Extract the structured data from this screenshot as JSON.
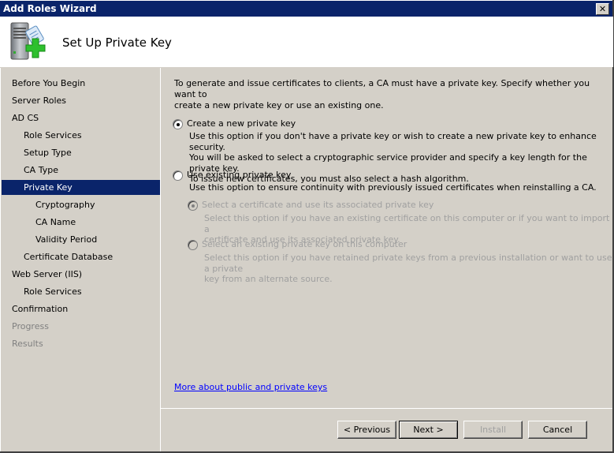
{
  "window": {
    "title": "Add Roles Wizard",
    "close_label": "✕"
  },
  "header": {
    "icon": "server-add-icon",
    "title": "Set Up Private Key"
  },
  "sidebar": {
    "items": [
      {
        "label": "Before You Begin",
        "level": 0,
        "state": "normal"
      },
      {
        "label": "Server Roles",
        "level": 0,
        "state": "normal"
      },
      {
        "label": "AD CS",
        "level": 0,
        "state": "normal"
      },
      {
        "label": "Role Services",
        "level": 1,
        "state": "normal"
      },
      {
        "label": "Setup Type",
        "level": 1,
        "state": "normal"
      },
      {
        "label": "CA Type",
        "level": 1,
        "state": "normal"
      },
      {
        "label": "Private Key",
        "level": 1,
        "state": "selected"
      },
      {
        "label": "Cryptography",
        "level": 2,
        "state": "normal"
      },
      {
        "label": "CA Name",
        "level": 2,
        "state": "normal"
      },
      {
        "label": "Validity Period",
        "level": 2,
        "state": "normal"
      },
      {
        "label": "Certificate Database",
        "level": 1,
        "state": "normal"
      },
      {
        "label": "Web Server (IIS)",
        "level": 0,
        "state": "normal"
      },
      {
        "label": "Role Services",
        "level": 1,
        "state": "normal"
      },
      {
        "label": "Confirmation",
        "level": 0,
        "state": "normal"
      },
      {
        "label": "Progress",
        "level": 0,
        "state": "disabled"
      },
      {
        "label": "Results",
        "level": 0,
        "state": "disabled"
      }
    ]
  },
  "main": {
    "intro_line1": "To generate and issue certificates to clients, a CA must have a private key. Specify whether you want to",
    "intro_line2": "create a new private key or use an existing one.",
    "options": {
      "create_new": {
        "label": "Create a new private key",
        "selected": true,
        "desc1": "Use this option if you don't have a private key or wish to create a new private key to enhance security.",
        "desc2": "You will be asked to select a cryptographic service provider and specify a key length for the private key.",
        "desc3": "To issue new certificates, you must also select a hash algorithm."
      },
      "use_existing": {
        "label": "Use existing private key",
        "selected": false,
        "desc1": "Use this option to ensure continuity with previously issued certificates when reinstalling a CA."
      },
      "select_certificate": {
        "label": "Select a certificate and use its associated private key",
        "selected": true,
        "enabled": false,
        "desc1": "Select this option if you have an existing certificate on this computer or if you want to import a",
        "desc2": "certificate and use its associated private key."
      },
      "select_existing_key": {
        "label": "Select an existing private key on this computer",
        "selected": false,
        "enabled": false,
        "desc1": "Select this option if you have retained private keys from a previous installation or want to use a private",
        "desc2": "key from an alternate source."
      }
    },
    "help_link": "More about public and private keys"
  },
  "footer": {
    "previous_label": "< Previous",
    "next_label": "Next >",
    "install_label": "Install",
    "cancel_label": "Cancel"
  }
}
